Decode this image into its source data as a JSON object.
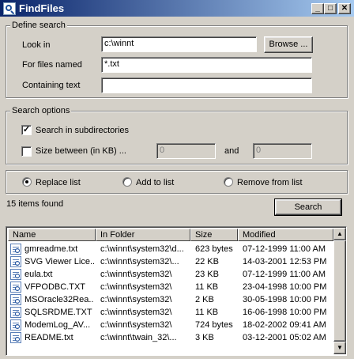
{
  "window": {
    "title": "FindFiles",
    "controls": {
      "minimize": "_",
      "maximize": "□",
      "close": "✕"
    }
  },
  "define_search": {
    "legend": "Define search",
    "look_in": {
      "label": "Look in",
      "value": "c:\\winnt"
    },
    "browse_button": "Browse ...",
    "files_named": {
      "label": "For files named",
      "value": "*.txt"
    },
    "containing_text": {
      "label": "Containing text",
      "value": ""
    }
  },
  "search_options": {
    "legend": "Search options",
    "subdirectories": {
      "label": "Search in subdirectories",
      "checked": true,
      "mark": "✓"
    },
    "size_between": {
      "label": "Size between (in KB) ...",
      "checked": false,
      "mark": "",
      "min": "0",
      "and_label": "and",
      "max": "0"
    }
  },
  "list_mode": {
    "options": [
      {
        "label": "Replace list",
        "selected": true
      },
      {
        "label": "Add to list",
        "selected": false
      },
      {
        "label": "Remove from list",
        "selected": false
      }
    ]
  },
  "status": "15 items found",
  "search_button": "Search",
  "results": {
    "columns": [
      "Name",
      "In Folder",
      "Size",
      "Modified"
    ],
    "rows": [
      {
        "name": "gmreadme.txt",
        "folder": "c:\\winnt\\system32\\d...",
        "size": "623 bytes",
        "modified": "07-12-1999 11:00 AM"
      },
      {
        "name": "SVG Viewer Lice...",
        "folder": "c:\\winnt\\system32\\...",
        "size": "22 KB",
        "modified": "14-03-2001 12:53 PM"
      },
      {
        "name": "eula.txt",
        "folder": "c:\\winnt\\system32\\",
        "size": "23 KB",
        "modified": "07-12-1999 11:00 AM"
      },
      {
        "name": "VFPODBC.TXT",
        "folder": "c:\\winnt\\system32\\",
        "size": "11 KB",
        "modified": "23-04-1998 10:00 PM"
      },
      {
        "name": "MSOracle32Rea...",
        "folder": "c:\\winnt\\system32\\",
        "size": "2 KB",
        "modified": "30-05-1998 10:00 PM"
      },
      {
        "name": "SQLSRDME.TXT",
        "folder": "c:\\winnt\\system32\\",
        "size": "11 KB",
        "modified": "16-06-1998 10:00 PM"
      },
      {
        "name": "ModemLog_AV...",
        "folder": "c:\\winnt\\system32\\",
        "size": "724 bytes",
        "modified": "18-02-2002 09:41 AM"
      },
      {
        "name": "README.txt",
        "folder": "c:\\winnt\\twain_32\\...",
        "size": "3 KB",
        "modified": "03-12-2001 05:02 AM"
      }
    ]
  },
  "scrollbar": {
    "up_arrow": "▲",
    "down_arrow": "▼"
  }
}
